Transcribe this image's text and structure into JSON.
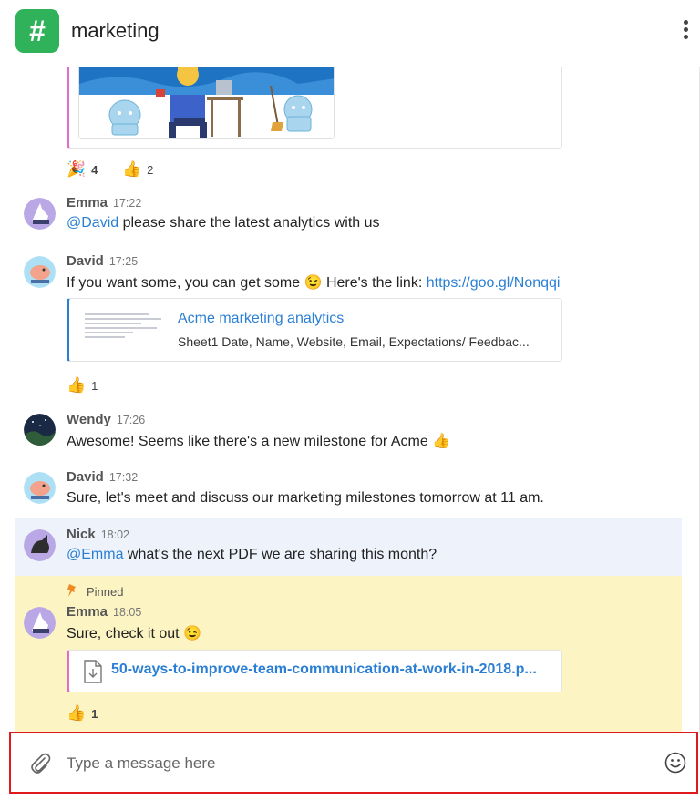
{
  "channel": {
    "icon_glyph": "#",
    "name": "marketing",
    "icon_color": "#2fb25a"
  },
  "top_card": {
    "accent": "#e36cc9"
  },
  "top_reactions": [
    {
      "icon": "party-popper-icon",
      "glyph": "🎉",
      "count": "4"
    },
    {
      "icon": "thumbs-up-icon",
      "glyph": "👍",
      "count": "2"
    }
  ],
  "messages": [
    {
      "author": "Emma",
      "time": "17:22",
      "mention": "@David",
      "text": " please share the latest analytics with us"
    },
    {
      "author": "David",
      "time": "17:25",
      "text": "If you want some, you can get some ",
      "emoji": "😉",
      "text2": " Here's the link: ",
      "link": "https://goo.gl/Nonqqi",
      "preview": {
        "title": "Acme marketing analytics",
        "description": "Sheet1 Date, Name, Website, Email, Expectations/ Feedbac..."
      },
      "reaction": {
        "glyph": "👍",
        "count": "1"
      }
    },
    {
      "author": "Wendy",
      "time": "17:26",
      "text": "Awesome! Seems like there's a new milestone for Acme ",
      "emoji": "👍"
    },
    {
      "author": "David",
      "time": "17:32",
      "text": "Sure, let's meet and discuss our marketing milestones tomorrow at 11 am."
    },
    {
      "author": "Nick",
      "time": "18:02",
      "mention": "@Emma",
      "text": " what's the next PDF we are sharing this month?"
    },
    {
      "pinned_label": "Pinned",
      "author": "Emma",
      "time": "18:05",
      "text": "Sure, check it out ",
      "emoji": "😉",
      "file": {
        "name": "50-ways-to-improve-team-communication-at-work-in-2018.p..."
      },
      "reaction": {
        "glyph": "👍",
        "count": "1"
      }
    }
  ],
  "composer": {
    "placeholder": "Type a message here"
  },
  "colors": {
    "link": "#2a7fd4",
    "highlight": "#edf2fb",
    "pinned_bg": "#fdf4c4",
    "focus_border": "#e01a1a"
  }
}
